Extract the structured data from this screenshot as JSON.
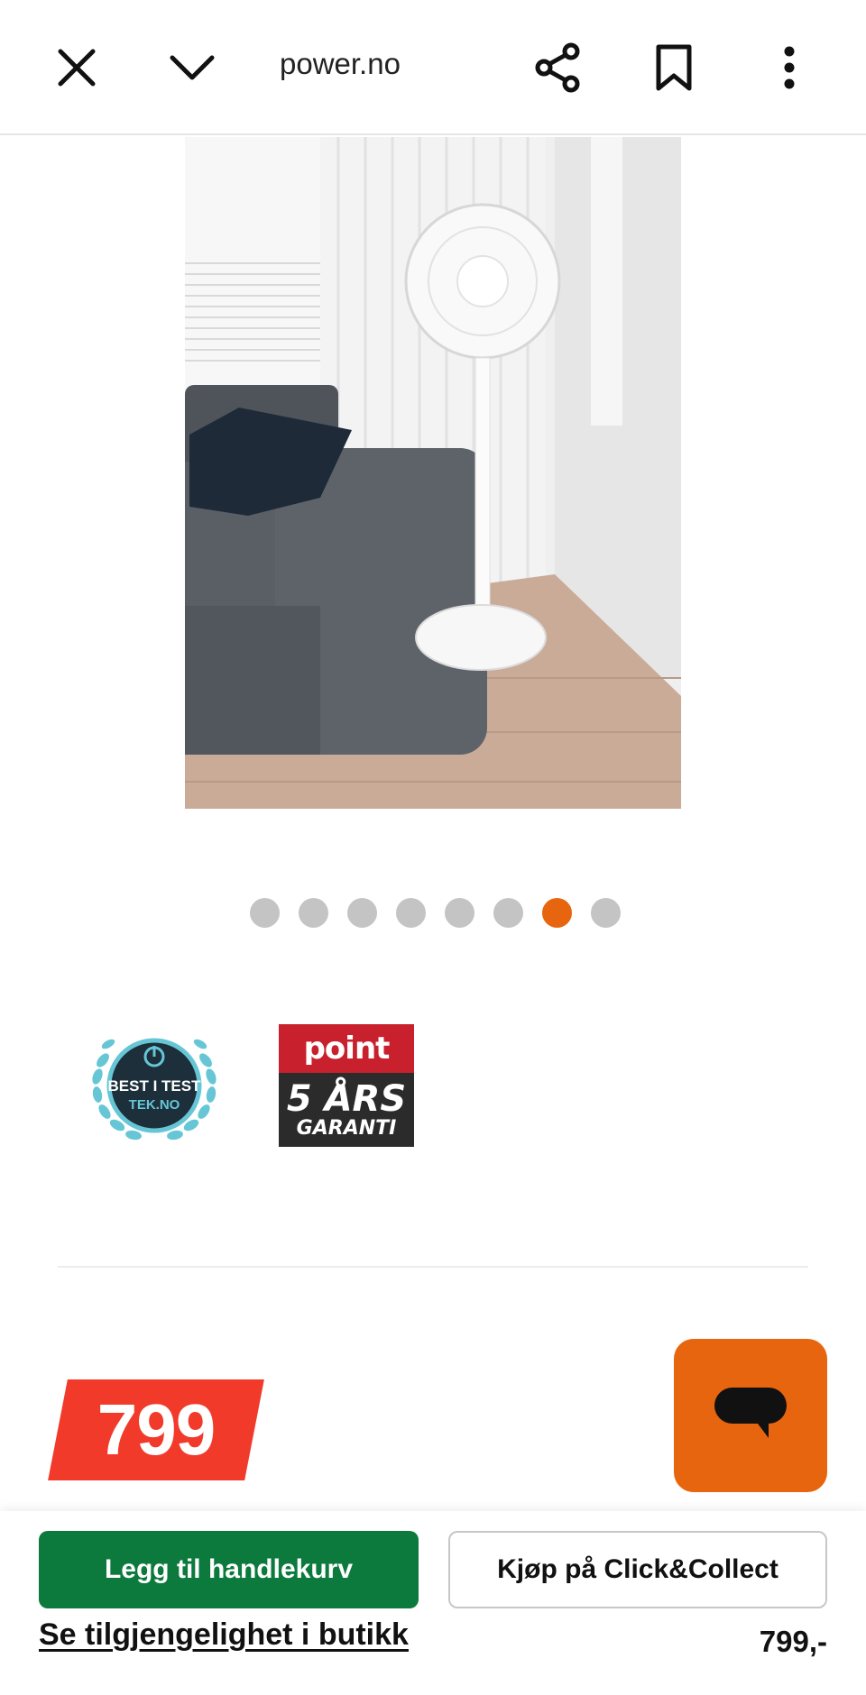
{
  "browser": {
    "url": "power.no",
    "icons": [
      "close-icon",
      "chevron-down-icon",
      "share-icon",
      "bookmark-icon",
      "more-vertical-icon"
    ]
  },
  "gallery": {
    "image_description_name": "product-photo-standing-fan",
    "dot_count": 8,
    "active_index": 6,
    "accent": "#e8650f"
  },
  "badges": {
    "test_line1": "BEST I TEST",
    "test_line2": "TEK.NO",
    "point_brand": "point",
    "point_line1": "5 ÅRS",
    "point_line2": "GARANTI"
  },
  "price": {
    "tag": "799",
    "bottom": "799,-"
  },
  "actions": {
    "add_to_cart": "Legg til handlekurv",
    "click_collect": "Kjøp på Click&Collect",
    "availability": "Se tilgjengelighet i butikk"
  },
  "colors": {
    "cart_green": "#0c7a3d",
    "price_red": "#f23a2b",
    "chat_orange": "#e8650f"
  }
}
